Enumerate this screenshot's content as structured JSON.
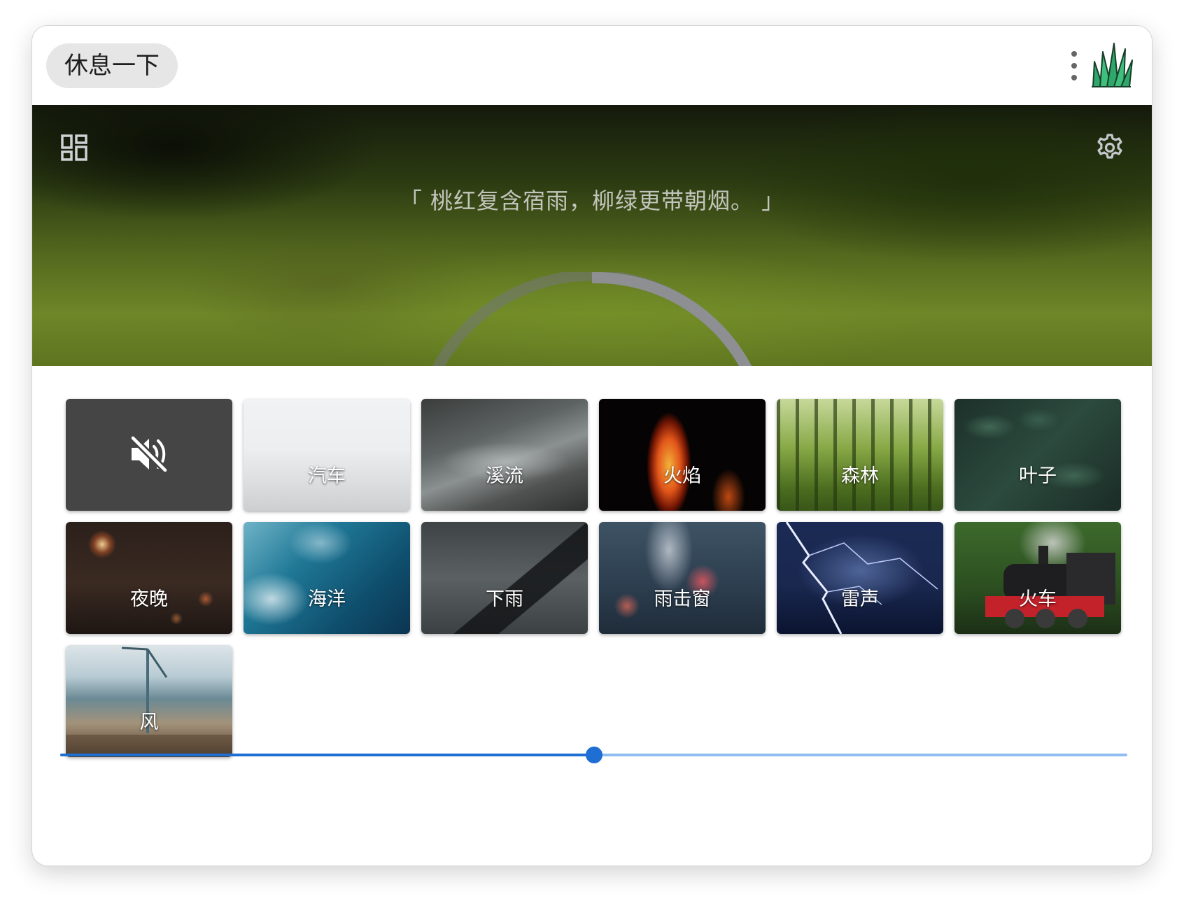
{
  "app": {
    "title": "休息一下"
  },
  "hero": {
    "quote": "「 桃红复含宿雨，柳绿更带朝烟。 」",
    "timer_progress": 0.5
  },
  "sounds": [
    {
      "id": "mute",
      "label": "",
      "icon": "volume-off-icon",
      "active": true
    },
    {
      "id": "car",
      "label": "汽车",
      "dimmed": true
    },
    {
      "id": "stream",
      "label": "溪流"
    },
    {
      "id": "fire",
      "label": "火焰"
    },
    {
      "id": "forest",
      "label": "森林"
    },
    {
      "id": "leaves",
      "label": "叶子"
    },
    {
      "id": "night",
      "label": "夜晚"
    },
    {
      "id": "ocean",
      "label": "海洋"
    },
    {
      "id": "rain",
      "label": "下雨"
    },
    {
      "id": "rain-window",
      "label": "雨击窗"
    },
    {
      "id": "thunder",
      "label": "雷声"
    },
    {
      "id": "train",
      "label": "火车"
    },
    {
      "id": "wind",
      "label": "风"
    }
  ],
  "volume": {
    "value": 0.5
  },
  "colors": {
    "accent": "#1f6ed4",
    "accent_light": "#8fbdf2",
    "mute_tile": "#454545",
    "ring": "#8d8f92"
  }
}
